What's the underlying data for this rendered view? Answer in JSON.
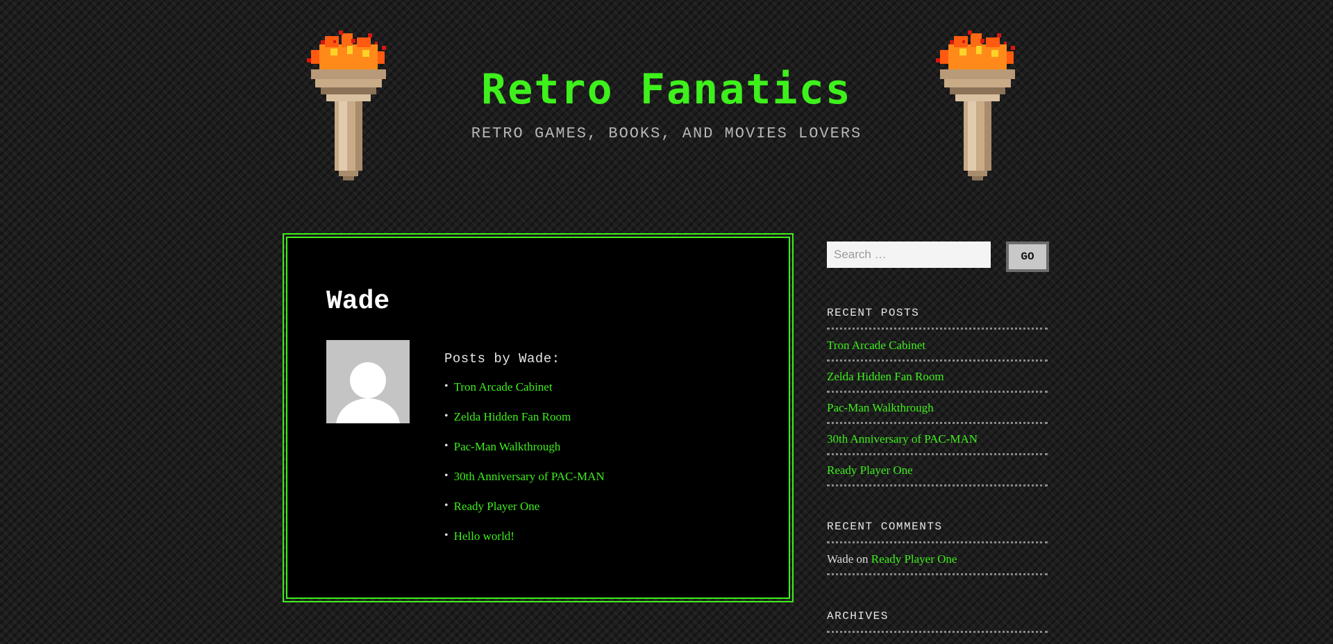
{
  "header": {
    "site_title": "Retro Fanatics",
    "site_description": "RETRO GAMES, BOOKS, AND MOVIES LOVERS"
  },
  "main": {
    "author_name": "Wade",
    "posts_heading": "Posts by Wade:",
    "posts": [
      {
        "title": "Tron Arcade Cabinet"
      },
      {
        "title": "Zelda Hidden Fan Room"
      },
      {
        "title": "Pac-Man Walkthrough"
      },
      {
        "title": "30th Anniversary of PAC-MAN"
      },
      {
        "title": "Ready Player One"
      },
      {
        "title": "Hello world!"
      }
    ]
  },
  "sidebar": {
    "search": {
      "placeholder": "Search …",
      "button_label": "GO"
    },
    "recent_posts": {
      "title": "RECENT POSTS",
      "items": [
        {
          "title": "Tron Arcade Cabinet"
        },
        {
          "title": "Zelda Hidden Fan Room"
        },
        {
          "title": "Pac-Man Walkthrough"
        },
        {
          "title": "30th Anniversary of PAC-MAN"
        },
        {
          "title": "Ready Player One"
        }
      ]
    },
    "recent_comments": {
      "title": "RECENT COMMENTS",
      "items": [
        {
          "author": "Wade",
          "connector": "on",
          "post": "Ready Player One"
        }
      ]
    },
    "archives": {
      "title": "ARCHIVES"
    }
  },
  "colors": {
    "accent": "#3ef01c",
    "background": "#1d1d1d",
    "panel": "#000000"
  }
}
